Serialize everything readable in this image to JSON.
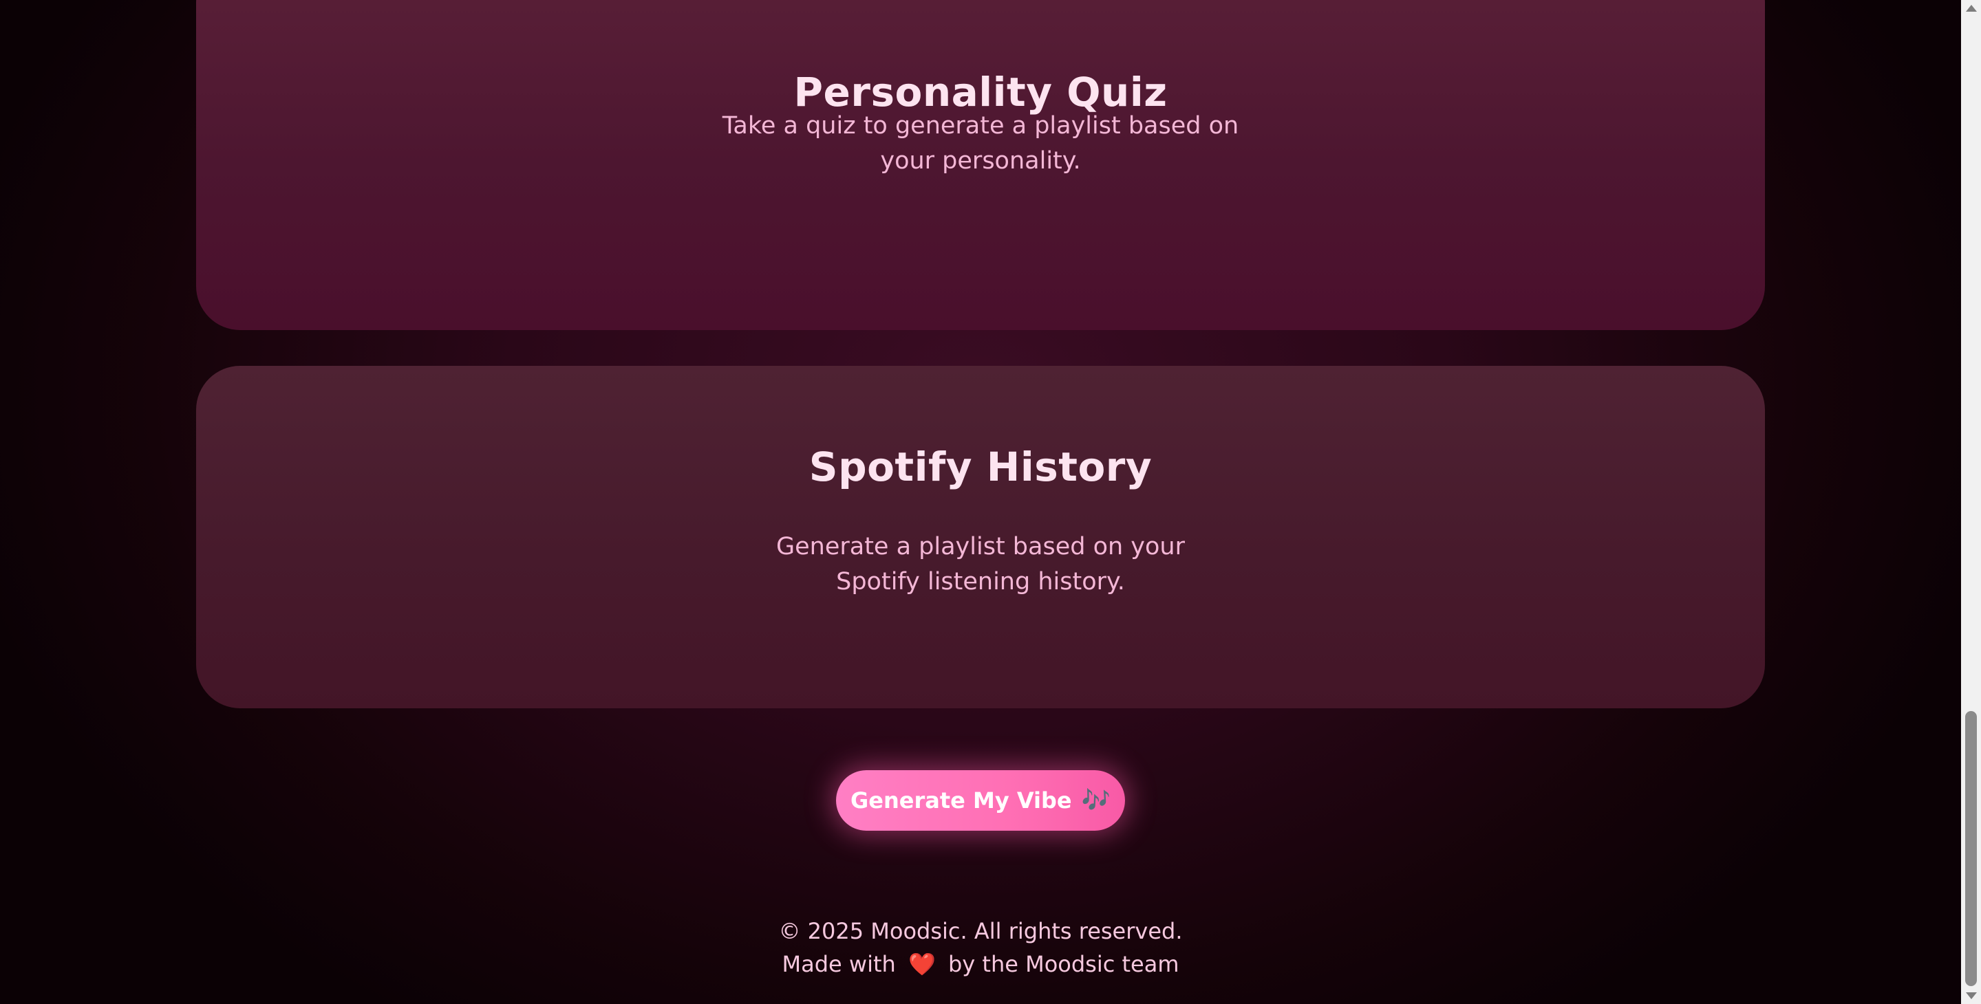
{
  "cards": {
    "quiz": {
      "title": "Personality Quiz",
      "description": "Take a quiz to generate a playlist based on your personality."
    },
    "spotify": {
      "title": "Spotify History",
      "description": "Generate a playlist based on your Spotify listening history."
    }
  },
  "cta": {
    "label": "Generate My Vibe",
    "icon": "music-notes-icon",
    "icon_glyph": "🎶"
  },
  "footer": {
    "copyright": "© 2025 Moodsic. All rights reserved.",
    "made_with_prefix": "Made with",
    "heart_glyph": "❤️",
    "made_with_suffix": "by the Moodsic team"
  },
  "colors": {
    "accent": "#ff6fb4",
    "title": "#fde4f0",
    "body_text": "#f4b7d6"
  }
}
